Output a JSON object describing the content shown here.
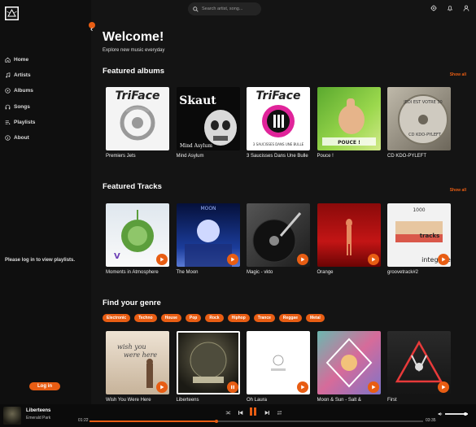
{
  "sidebar": {
    "nav": [
      {
        "label": "Home",
        "icon": "home-icon"
      },
      {
        "label": "Artists",
        "icon": "music-note-icon"
      },
      {
        "label": "Albums",
        "icon": "disc-icon"
      },
      {
        "label": "Songs",
        "icon": "headphones-icon"
      },
      {
        "label": "Playlists",
        "icon": "playlist-icon"
      },
      {
        "label": "About",
        "icon": "info-icon"
      }
    ],
    "login_message": "Please log in to view playlists.",
    "login_button": "Log in"
  },
  "header": {
    "search_placeholder": "Search artist, song..."
  },
  "main": {
    "welcome": "Welcome!",
    "tagline": "Explore new music everyday",
    "featured_albums_title": "Featured albums",
    "featured_tracks_title": "Featured Tracks",
    "genre_title": "Find your genre",
    "show_all": "Show all",
    "albums": [
      {
        "title": "Premiers Jets"
      },
      {
        "title": "Mind Asylum"
      },
      {
        "title": "3 Saucisses Dans Une Bulle"
      },
      {
        "title": "Pouce !"
      },
      {
        "title": "CD KDO-PYLEFT"
      }
    ],
    "tracks": [
      {
        "title": "Moments in Atmosphere"
      },
      {
        "title": "The Moon"
      },
      {
        "title": "Magic - vkto"
      },
      {
        "title": "Orange"
      },
      {
        "title": "groovetrack#2"
      }
    ],
    "genres": [
      "Electronic",
      "Techno",
      "House",
      "Pop",
      "Rock",
      "Hiphop",
      "Trance",
      "Reggae",
      "Metal"
    ],
    "genre_tracks": [
      {
        "title": "Wish You Were Here"
      },
      {
        "title": "Liberteens"
      },
      {
        "title": "Oh Laura"
      },
      {
        "title": "Moon & Sun - Salt &"
      },
      {
        "title": "First"
      }
    ]
  },
  "player": {
    "title": "Liberteens",
    "artist": "Emerald Park",
    "elapsed": "01:22",
    "duration": "03:35",
    "progress": 0.38,
    "volume": 0.9,
    "state": "playing"
  },
  "colors": {
    "accent": "#e85d13",
    "background": "#141414",
    "sidebar": "#0f0f0f"
  }
}
